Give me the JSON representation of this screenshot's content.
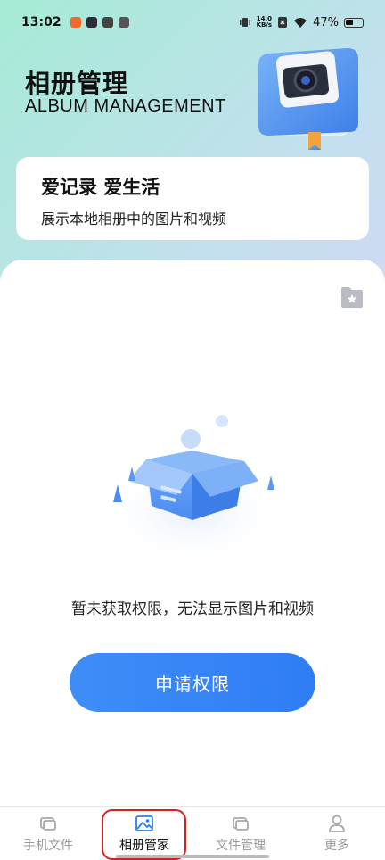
{
  "status": {
    "time": "13:02",
    "speed_value": "14.0",
    "speed_unit": "KB/s",
    "battery": "47%"
  },
  "header": {
    "title": "相册管理",
    "subtitle": "ALBUM MANAGEMENT"
  },
  "slogan": {
    "title": "爱记录 爱生活",
    "description": "展示本地相册中的图片和视频"
  },
  "empty_state": {
    "message": "暂未获取权限，无法显示图片和视频",
    "button_label": "申请权限"
  },
  "bottom_nav": {
    "items": [
      {
        "label": "手机文件",
        "icon": "phone-file-icon",
        "active": false
      },
      {
        "label": "相册管家",
        "icon": "image-icon",
        "active": true
      },
      {
        "label": "文件管理",
        "icon": "folder-icon",
        "active": false
      },
      {
        "label": "更多",
        "icon": "person-icon",
        "active": false
      }
    ]
  },
  "colors": {
    "accent": "#3a88f7",
    "highlight": "#d92020"
  }
}
